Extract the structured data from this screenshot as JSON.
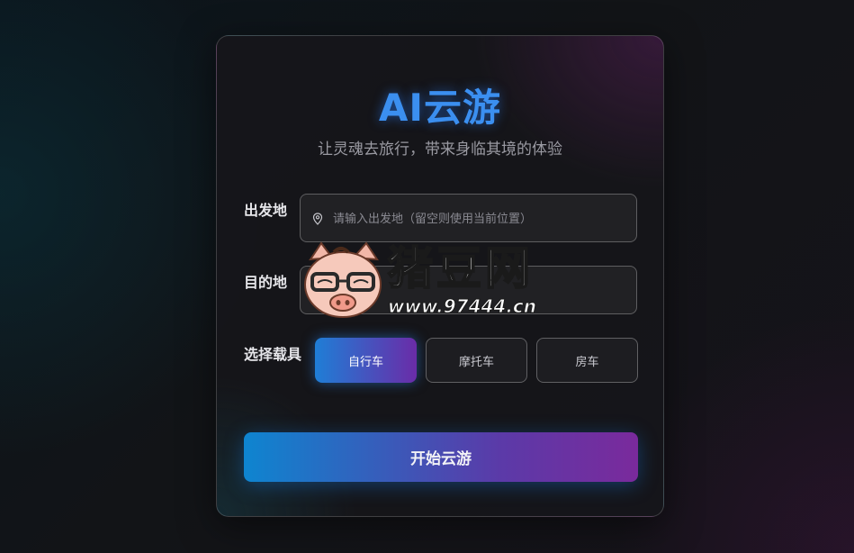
{
  "card": {
    "title": "AI云游",
    "subtitle": "让灵魂去旅行，带来身临其境的体验"
  },
  "form": {
    "origin": {
      "label": "出发地",
      "placeholder": "请输入出发地（留空则使用当前位置）",
      "icon": "location-pin-icon"
    },
    "destination": {
      "label": "目的地",
      "placeholder": "想去的地方"
    },
    "vehicle": {
      "label": "选择载具",
      "options": [
        "自行车",
        "摩托车",
        "房车"
      ],
      "selected": "自行车"
    },
    "submit_label": "开始云游"
  },
  "watermark": {
    "brand": "猪豆网",
    "url": "www.97444.cn"
  },
  "colors": {
    "accent": "#3b8ff0",
    "gradient_start": "#1f7ed6",
    "gradient_end": "#7a2a9c"
  }
}
